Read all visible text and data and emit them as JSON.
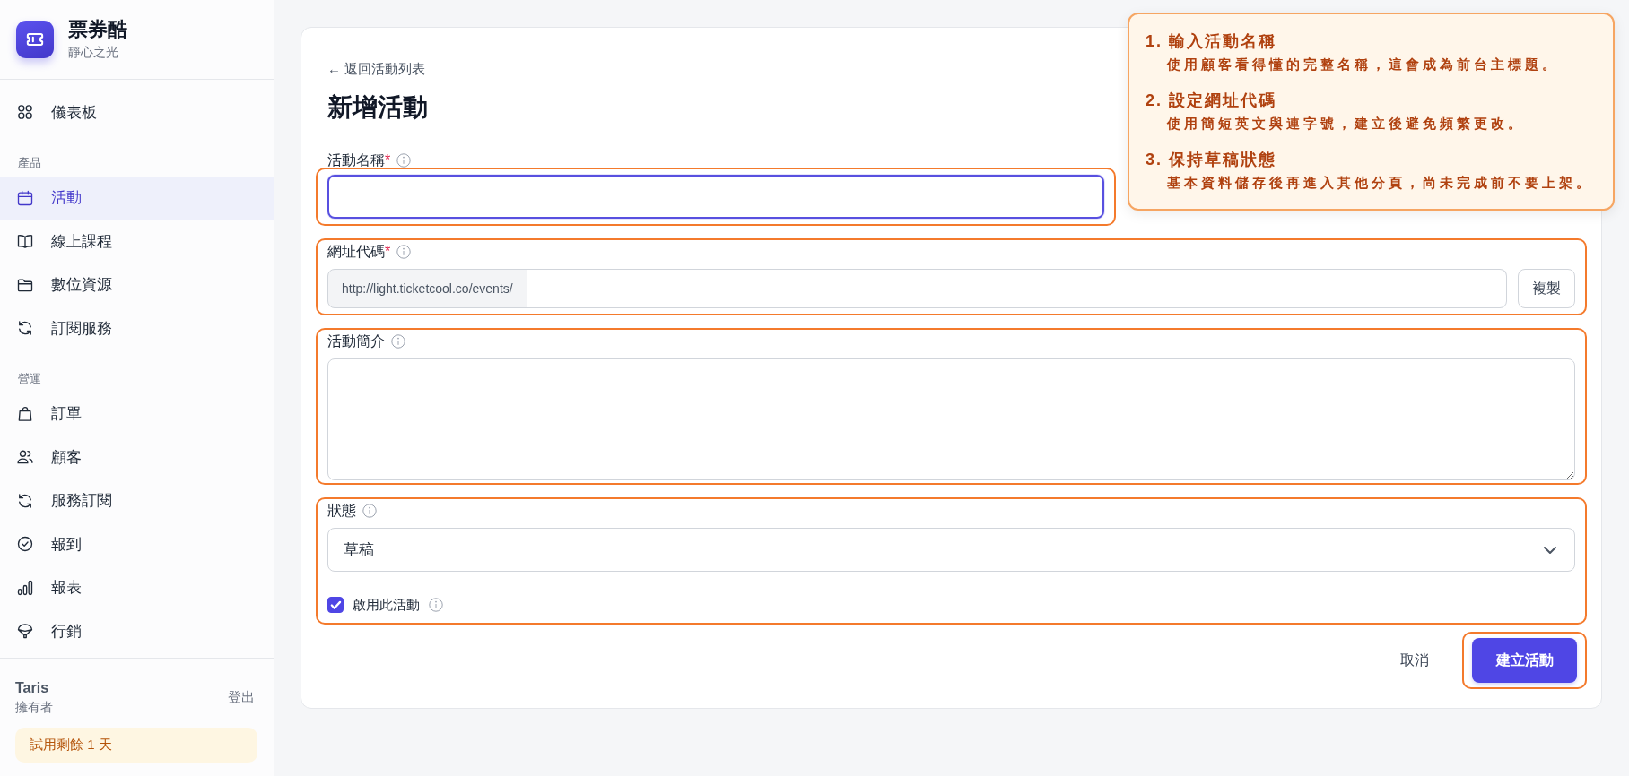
{
  "sidebar": {
    "brand": {
      "name": "票券酷",
      "subtitle": "靜心之光"
    },
    "groups": [
      {
        "items": [
          {
            "label": "儀表板",
            "selected": false
          }
        ]
      },
      {
        "title": "產品",
        "items": [
          {
            "label": "活動",
            "selected": true
          },
          {
            "label": "線上課程",
            "selected": false
          },
          {
            "label": "數位資源",
            "selected": false
          },
          {
            "label": "訂閱服務",
            "selected": false
          }
        ]
      },
      {
        "title": "營運",
        "items": [
          {
            "label": "訂單",
            "selected": false
          },
          {
            "label": "顧客",
            "selected": false
          },
          {
            "label": "服務訂閱",
            "selected": false
          },
          {
            "label": "報到",
            "selected": false
          },
          {
            "label": "報表",
            "selected": false
          },
          {
            "label": "行銷",
            "selected": false
          }
        ]
      }
    ],
    "user": {
      "name": "Taris",
      "role": "擁有者",
      "logout": "登出"
    },
    "trial_banner": "試用剩餘 1 天"
  },
  "page": {
    "back_link": "← 返回活動列表",
    "title": "新增活動",
    "fields": [
      {
        "kind": "text",
        "label": "活動名稱",
        "required_mark": "*",
        "highlighted": true,
        "focused": true
      },
      {
        "kind": "url",
        "label": "網址代碼",
        "required_mark": "*",
        "prefix": "http://light.ticketcool.co/events/",
        "button": "複製",
        "highlighted": true,
        "focused": false
      },
      {
        "kind": "textarea",
        "label": "活動簡介",
        "highlighted": true,
        "focused": false
      },
      {
        "kind": "select",
        "label": "狀態",
        "value": "草稿",
        "highlighted": true,
        "focused": false,
        "checkbox": {
          "label": "啟用此活動",
          "checked": true
        }
      }
    ],
    "actions": [
      {
        "kind": "text",
        "label": "取消",
        "highlighted": false
      },
      {
        "kind": "primary",
        "label": "建立活動",
        "highlighted": true
      }
    ]
  },
  "guide": {
    "steps": [
      {
        "title": "1. 輸入活動名稱",
        "description": "使用顧客看得懂的完整名稱，這會成為前台主標題。"
      },
      {
        "title": "2. 設定網址代碼",
        "description": "使用簡短英文與連字號，建立後避免頻繁更改。"
      },
      {
        "title": "3. 保持草稿狀態",
        "description": "基本資料儲存後再進入其他分頁，尚未完成前不要上架。"
      }
    ]
  }
}
